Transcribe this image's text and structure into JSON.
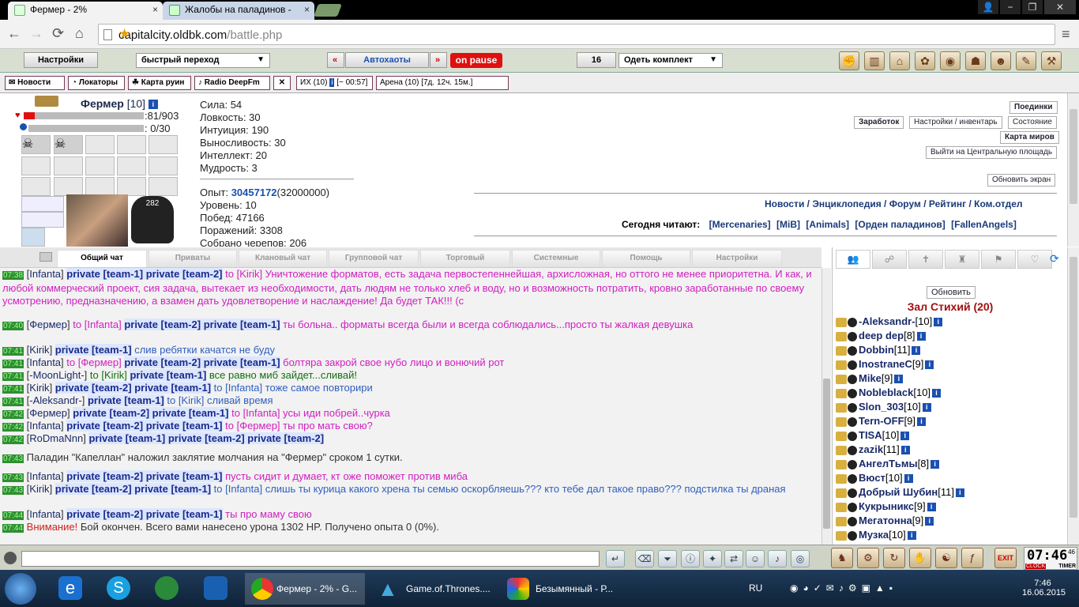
{
  "browser": {
    "tabs": [
      {
        "title": "Фермер - 2%",
        "close": "×"
      },
      {
        "title": "Жалобы на паладинов - ",
        "close": "×"
      }
    ],
    "url_host": "capitalcity.oldbk.com",
    "url_path": "/battle.php",
    "nav": {
      "back": "←",
      "forward": "→",
      "reload": "⟳",
      "home": "⌂",
      "star": "★",
      "menu": "≡"
    },
    "window": {
      "user": "👤",
      "min": "−",
      "max": "❐",
      "close": "✕"
    }
  },
  "gamebar": {
    "settings": "Настройки",
    "quick_nav": "быстрый переход",
    "prev": "«",
    "autoattack": "Автохаоты",
    "next": "»",
    "pause": "on pause",
    "kit_count": "16",
    "kit_label": "Одеть комплект",
    "arrow": "▼"
  },
  "linkbar": {
    "links": [
      "Новости",
      "Локаторы",
      "Карта руин",
      "Radio DeepFm"
    ],
    "ih": "ИХ (10)",
    "ih_time": "[~ 00:57]",
    "arena": "Арена (10) [7д. 12ч. 15м.]"
  },
  "character": {
    "name": "Фермер",
    "level": "[10]",
    "hp": ":81/903",
    "mana": ": 0/30",
    "hp_fraction": 0.09,
    "stats": [
      "Сила: 54",
      "Ловкость: 30",
      "Интуиция: 190",
      "Выносливость: 30",
      "Интеллект: 20",
      "Мудрость: 3"
    ],
    "exp_label": "Опыт:",
    "exp_value": "30457172",
    "exp_next": "(32000000)",
    "info": [
      "Уровень: 10",
      "Побед: 47166",
      "Поражений: 3308",
      "Собрано черепов: 206"
    ]
  },
  "right_buttons": {
    "duels": "Поединки",
    "earnings": "Заработок",
    "settings_inventory": "Настройки / инвентарь",
    "state": "Состояние",
    "world_map": "Карта миров",
    "exit_square": "Выйти на Центральную площадь",
    "refresh": "Обновить экран"
  },
  "nav_links": "Новости / Энциклопедия / Форум / Рейтинг / Ком.отдел",
  "reading": {
    "label": "Сегодня читают:",
    "items": [
      "[Mercenaries]",
      "[MiB]",
      "[Animals]",
      "[Орден паладинов]",
      "[FallenAngels]"
    ]
  },
  "chat_tabs": [
    "Общий чат",
    "Приваты",
    "Клановый чат",
    "Групповой чат",
    "Торговый",
    "Системные",
    "Помощь",
    "Настройки"
  ],
  "chat": [
    {
      "t": "07:38",
      "parts": [
        [
          "[",
          ""
        ],
        [
          "Infanta",
          "nk"
        ],
        [
          "] ",
          ""
        ],
        [
          "private [team-1] private [team-2]",
          "pv"
        ],
        [
          " to [Kirik] Уничтожение форматов, есть задача первостепеннейшая, архисложная, но оттого не менее приоритетна. И как, и любой коммерческий проект, сия задача, вытекает из необходимости, дать людям не только хлеб и воду, но и возможность потратить, кровно заработанные по своему усмотрению, предназначению, а взамен дать удовлетворение и наслаждение! Да будет ТАК!!! (с",
          "pink"
        ]
      ]
    },
    {
      "t": "07:40",
      "parts": [
        [
          "[",
          ""
        ],
        [
          "Фермер",
          "nk"
        ],
        [
          "] ",
          ""
        ],
        [
          "to [Infanta] ",
          "pink"
        ],
        [
          "private [team-2] private [team-1]",
          "pv"
        ],
        [
          " ты больна.. форматы всегда были и всегда соблюдались...просто ты жалкая девушка",
          "pink"
        ]
      ]
    },
    {
      "t": "07:41",
      "parts": [
        [
          "[",
          ""
        ],
        [
          "Kirik",
          "nk"
        ],
        [
          "] ",
          ""
        ],
        [
          "private [team-1]",
          "pv"
        ],
        [
          " слив ребятки качатся не буду",
          "blue"
        ]
      ]
    },
    {
      "t": "07:41",
      "parts": [
        [
          "[",
          ""
        ],
        [
          "Infanta",
          "nk"
        ],
        [
          "] ",
          ""
        ],
        [
          "to [Фермер] ",
          "pink"
        ],
        [
          "private [team-2] private [team-1]",
          "pv"
        ],
        [
          " болтяра закрой свое нубо лицо и вонючий рот",
          "pink"
        ]
      ]
    },
    {
      "t": "07:41",
      "parts": [
        [
          "[",
          ""
        ],
        [
          "-MoonLight-",
          "nk"
        ],
        [
          "] ",
          ""
        ],
        [
          "to [Kirik] ",
          "grn"
        ],
        [
          "private [team-1]",
          "pv"
        ],
        [
          " все равно миб зайдет...сливай!",
          "grn"
        ]
      ]
    },
    {
      "t": "07:41",
      "parts": [
        [
          "[",
          ""
        ],
        [
          "Kirik",
          "nk"
        ],
        [
          "] ",
          ""
        ],
        [
          "private [team-2] private [team-1]",
          "pv"
        ],
        [
          " to [Infanta] тоже самое повторири",
          "blue"
        ]
      ]
    },
    {
      "t": "07:41",
      "parts": [
        [
          "[",
          ""
        ],
        [
          "-Aleksandr-",
          "nk"
        ],
        [
          "] ",
          ""
        ],
        [
          "private [team-1]",
          "pv"
        ],
        [
          " to [Kirik] сливай время",
          "blue"
        ]
      ]
    },
    {
      "t": "07:42",
      "parts": [
        [
          "[",
          ""
        ],
        [
          "Фермер",
          "nk"
        ],
        [
          "] ",
          ""
        ],
        [
          "private [team-2] private [team-1]",
          "pv"
        ],
        [
          " to [Infanta] усы иди побрей..чурка",
          "pink"
        ]
      ]
    },
    {
      "t": "07:42",
      "parts": [
        [
          "[",
          ""
        ],
        [
          "Infanta",
          "nk"
        ],
        [
          "] ",
          ""
        ],
        [
          "private [team-2] private [team-1]",
          "pv"
        ],
        [
          " to [Фермер] ты про мать свою?",
          "pink"
        ]
      ]
    },
    {
      "t": "07:42",
      "parts": [
        [
          "[",
          ""
        ],
        [
          "RoDmaNnn",
          "nk"
        ],
        [
          "] ",
          ""
        ],
        [
          "private [team-1] private [team-2] private [team-2]",
          "pv"
        ]
      ]
    },
    {
      "t": "07:43",
      "parts": [
        [
          "Паладин \"Капеллан\" наложил заклятие молчания на \"Фермер\" сроком 1 сутки.",
          ""
        ]
      ]
    },
    {
      "t": "07:43",
      "parts": [
        [
          "[",
          ""
        ],
        [
          "Infanta",
          "nk"
        ],
        [
          "] ",
          ""
        ],
        [
          "private [team-2] private [team-1]",
          "pv"
        ],
        [
          " пусть сидит и думает, кт оже поможет против миба",
          "pink"
        ]
      ]
    },
    {
      "t": "07:43",
      "parts": [
        [
          "[",
          ""
        ],
        [
          "Kirik",
          "nk"
        ],
        [
          "] ",
          ""
        ],
        [
          "private [team-2] private [team-1]",
          "pv"
        ],
        [
          " to [Infanta] слишь ты курица какого хрена ты семью оскорбляешь??? кто тебе дал такое право??? подстилка ты драная",
          "blue"
        ]
      ]
    },
    {
      "t": "07:44",
      "parts": [
        [
          "[",
          ""
        ],
        [
          "Infanta",
          "nk"
        ],
        [
          "] ",
          ""
        ],
        [
          "private [team-2] private [team-1]",
          "pv"
        ],
        [
          " ты про маму свою",
          "pink"
        ]
      ]
    },
    {
      "t": "07:44",
      "parts": [
        [
          "Внимание!",
          "red"
        ],
        [
          " Бой окончен. Всего вами нанесено урона 1302 HP. Получено опыта 0 (0%).",
          ""
        ]
      ]
    }
  ],
  "room": {
    "refresh": "Обновить",
    "title": "Зал Стихий (20)",
    "users": [
      {
        "name": "-Aleksandr-",
        "lv": "[10]"
      },
      {
        "name": "deep dep",
        "lv": "[8]"
      },
      {
        "name": "Dobbin",
        "lv": "[11]"
      },
      {
        "name": "InostraneC",
        "lv": "[9]"
      },
      {
        "name": "Mike",
        "lv": "[9]"
      },
      {
        "name": "Nobleblack",
        "lv": "[10]"
      },
      {
        "name": "Slon_303",
        "lv": "[10]"
      },
      {
        "name": "Tern-OFF",
        "lv": "[9]"
      },
      {
        "name": "TISA",
        "lv": "[10]"
      },
      {
        "name": "zazik",
        "lv": "[11]"
      },
      {
        "name": "АнгелТьмы",
        "lv": "[8]"
      },
      {
        "name": "Вюст",
        "lv": "[10]"
      },
      {
        "name": "Добрый Шубин",
        "lv": "[11]"
      },
      {
        "name": "Кукрыникс",
        "lv": "[9]"
      },
      {
        "name": "Мегатонна",
        "lv": "[9]"
      },
      {
        "name": "Музка",
        "lv": "[10]"
      }
    ]
  },
  "clock": {
    "time": "07:46",
    "sec": "46",
    "label1": "CLOCK",
    "label2": "TIMER",
    "exit": "EXIT"
  },
  "taskbar": {
    "items": [
      "Фермер - 2% - G...",
      "Game.of.Thrones....",
      "Безымянный - Р..."
    ],
    "lang": "RU",
    "time": "7:46",
    "date": "16.06.2015"
  },
  "colors": {
    "accent": "#1a2a6a",
    "pause_bg": "#e01010",
    "pink": "#d020c0",
    "time_bg": "#2f8f2f"
  }
}
